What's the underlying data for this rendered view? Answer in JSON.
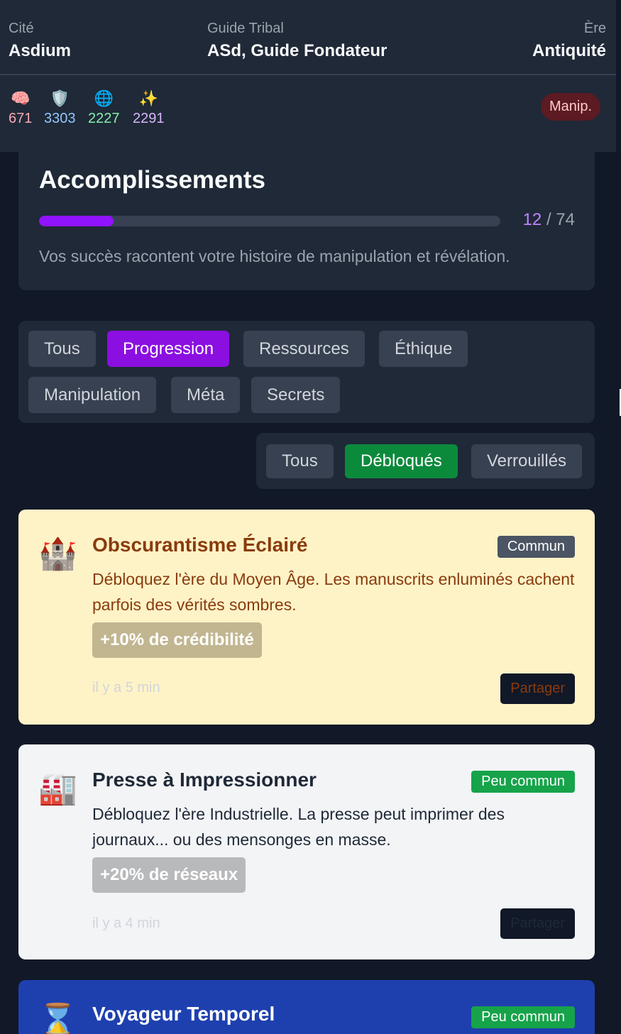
{
  "header": {
    "city": {
      "label": "Cité",
      "value": "Asdium"
    },
    "guide": {
      "label": "Guide Tribal",
      "value": "ASd, Guide Fondateur"
    },
    "era": {
      "label": "Ère",
      "value": "Antiquité"
    },
    "stats": [
      {
        "icon": "brain-icon",
        "glyph": "🧠",
        "value": "671"
      },
      {
        "icon": "shield-icon",
        "glyph": "🛡️",
        "value": "3303"
      },
      {
        "icon": "globe-icon",
        "glyph": "🌐",
        "value": "2227"
      },
      {
        "icon": "sparkles-icon",
        "glyph": "✨",
        "value": "2291"
      }
    ],
    "mode_badge": "Manip."
  },
  "achievements": {
    "title": "Accomplissements",
    "unlocked": "12",
    "separator": " / ",
    "total": "74",
    "progress_fraction": 0.162,
    "description": "Vos succès racontent votre histoire de manipulation et révélation."
  },
  "categories": {
    "items": [
      "Tous",
      "Progression",
      "Ressources",
      "Éthique",
      "Manipulation",
      "Méta",
      "Secrets"
    ],
    "selected": "Progression"
  },
  "status_filter": {
    "items": [
      "Tous",
      "Débloqués",
      "Verrouillés"
    ],
    "selected": "Débloqués"
  },
  "cards": [
    {
      "icon": "castle-icon",
      "glyph": "🏰",
      "title": "Obscurantisme Éclairé",
      "rarity": "Commun",
      "description": "Débloquez l'ère du Moyen Âge. Les manuscrits enluminés cachent parfois des vérités sombres.",
      "bonus": "+10% de crédibilité",
      "time": "il y a 5 min",
      "share": "Partager"
    },
    {
      "icon": "factory-icon",
      "glyph": "🏭",
      "title": "Presse à Impressionner",
      "rarity": "Peu commun",
      "description": "Débloquez l'ère Industrielle. La presse peut imprimer des journaux... ou des mensonges en masse.",
      "bonus": "+20% de réseaux",
      "time": "il y a 4 min",
      "share": "Partager"
    },
    {
      "icon": "hourglass-icon",
      "glyph": "⌛",
      "title": "Voyageur Temporel",
      "rarity": "Peu commun"
    }
  ],
  "colors": {
    "background": "#111827",
    "panel": "#1f2937",
    "accent_purple": "#8b0fe0",
    "accent_green": "#0c8a3c",
    "manip_badge": "#5c1a22"
  }
}
